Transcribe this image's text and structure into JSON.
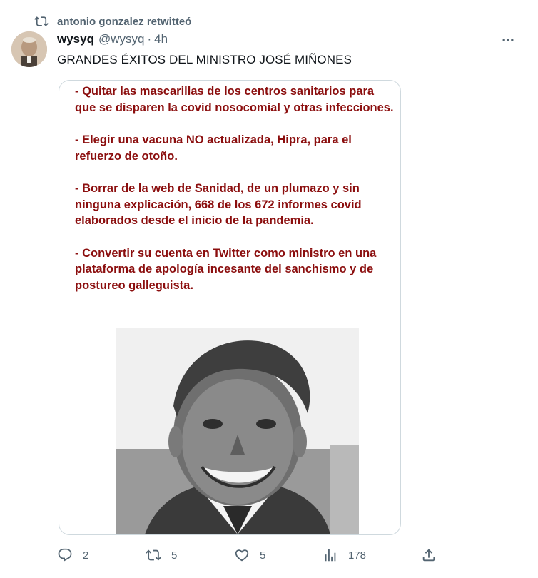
{
  "retweet": {
    "icon": "retweet-icon",
    "text": "antonio gonzalez retwitteó"
  },
  "author": {
    "name": "wysyq",
    "handle": "@wysyq",
    "separator": "·",
    "time": "4h",
    "avatar": "avatar"
  },
  "more_icon": "more-icon",
  "tweet": {
    "text": "GRANDES ÉXITOS DEL MINISTRO JOSÉ MIÑONES",
    "image_bullets": [
      "- Quitar las mascarillas de los centros sanitarios para que se disparen la covid nosocomial y otras infecciones.",
      "- Elegir una vacuna NO actualizada, Hipra, para el refuerzo de otoño.",
      "- Borrar de la web de Sanidad, de un plumazo y sin ninguna explicación, 668 de los 672 informes covid elaborados desde el inicio de la pandemia.",
      "- Convertir su cuenta en Twitter como ministro en una plataforma de apología incesante del sanchismo y de postureo galleguista."
    ],
    "image_text_color": "#8b0e0e"
  },
  "actions": {
    "reply": {
      "icon": "reply-icon",
      "count": "2"
    },
    "retweet": {
      "icon": "retweet-icon",
      "count": "5"
    },
    "like": {
      "icon": "heart-icon",
      "count": "5"
    },
    "views": {
      "icon": "views-icon",
      "count": "178"
    },
    "share": {
      "icon": "share-icon"
    }
  },
  "colors": {
    "secondary_text": "#536471",
    "primary_text": "#0f1419",
    "border": "#cfd9de"
  }
}
